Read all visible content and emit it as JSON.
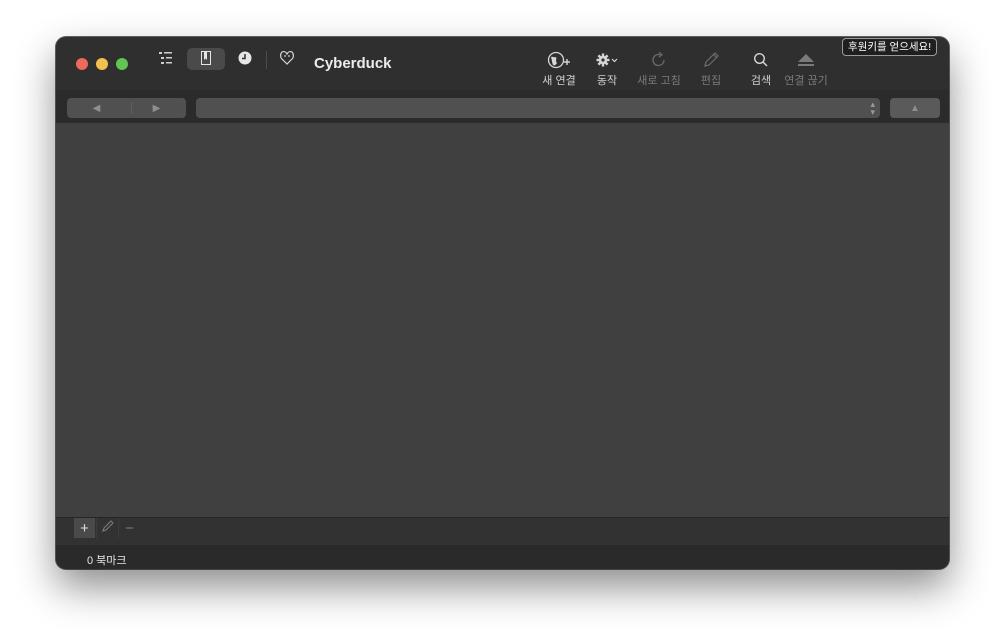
{
  "app": {
    "title": "Cyberduck"
  },
  "toolbar": {
    "new_connection": "새 연결",
    "action": "동작",
    "refresh": "새로 고침",
    "edit": "편집",
    "search": "검색",
    "disconnect": "연결 끊기"
  },
  "donate": {
    "label": "후원키를 얻으세요!"
  },
  "status": {
    "text": "0 북마크"
  },
  "icons": {
    "outline_view": "outline-view-icon",
    "bookmarks_view": "bookmark-icon",
    "history_view": "clock-icon",
    "bonjour_view": "bonjour-icon",
    "new_connection": "globe-plus-icon",
    "action": "gear-icon",
    "refresh": "refresh-icon",
    "edit": "pencil-icon",
    "search": "search-icon",
    "disconnect": "eject-icon"
  },
  "colors": {
    "close": "#ec6a5e",
    "minimize": "#f4bf4f",
    "maximize": "#61c554"
  }
}
